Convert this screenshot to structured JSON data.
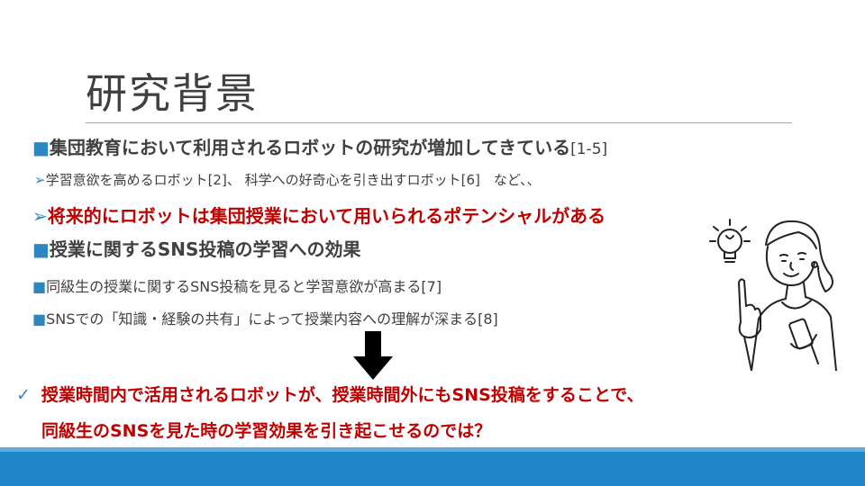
{
  "slide": {
    "title": "研究背景",
    "bullets": [
      {
        "marker": "■",
        "text": "集団教育において利用されるロボットの研究が増加してきている",
        "ref": "[1-5]"
      },
      {
        "marker": "➢",
        "text": "学習意欲を高めるロボット[2]、 科学への好奇心を引き出すロボット[6]　など、、"
      },
      {
        "marker": "➢",
        "text": "将来的にロボットは集団授業において用いられるポテンシャルがある"
      },
      {
        "marker": "■",
        "text": "授業に関するSNS投稿の学習への効果"
      },
      {
        "marker": "■",
        "text": "同級生の授業に関するSNS投稿を見ると学習意欲が高まる[7]"
      },
      {
        "marker": "■",
        "text": "SNSでの「知識・経験の共有」によって授業内容への理解が深まる[8]"
      }
    ],
    "conclusion": {
      "marker": "✓",
      "line1": "授業時間内で活用されるロボットが、授業時間外にもSNS投稿をすることで、",
      "line2": "同級生のSNSを見た時の学習効果を引き起こせるのでは？"
    },
    "colors": {
      "accent": "#2e86c1",
      "highlight": "#c00000",
      "text": "#404040",
      "bar": "#1f87c8"
    },
    "icons": {
      "down_arrow": "down-arrow-icon",
      "illustration": "girl-with-lightbulb-illustration"
    }
  }
}
